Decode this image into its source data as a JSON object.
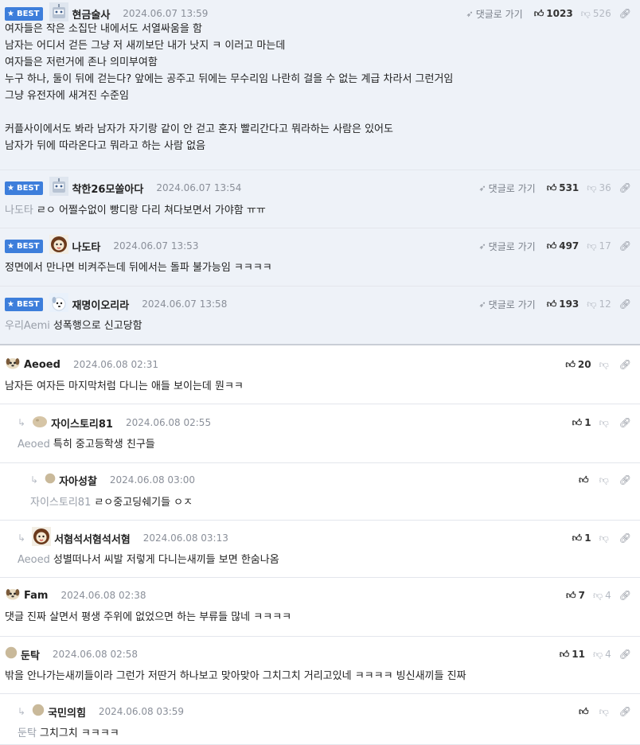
{
  "labels": {
    "best": "BEST",
    "goto": "댓글로 가기"
  },
  "colors": {
    "best_bg": "#eef2f8",
    "badge": "#3d7edb"
  },
  "comments": [
    {
      "best": true,
      "nick": "현금술사",
      "date": "2024.06.07 13:59",
      "likes": "1023",
      "dislikes": "526",
      "avatar": "robot-avatar",
      "lines": [
        "여자들은 작은 소집단 내에서도 서열싸움을 함",
        "남자는 어디서 걷든 그냥 저 새끼보단 내가 낫지 ㅋ 이러고 마는데",
        "여자들은 저런거에 존나 의미부여함",
        "누구 하나, 둘이 뒤에 걷는다? 앞에는 공주고 뒤에는 무수리임 나란히 걸을 수 없는 계급 차라서 그런거임",
        "그냥 유전자에 새겨진 수준임",
        "",
        "커플사이에서도 봐라 남자가 자기랑 같이 안 걷고 혼자 빨리간다고 뭐라하는 사람은 있어도",
        "남자가 뒤에 따라온다고 뭐라고 하는 사람 없음"
      ]
    },
    {
      "best": true,
      "nick": "착한26모쏠아다",
      "date": "2024.06.07 13:54",
      "likes": "531",
      "dislikes": "36",
      "avatar": "robot-avatar",
      "mention": "나도타",
      "text": "ㄹㅇ 어쩔수없이 빵디랑 다리 쳐다보면서 가야함 ㅠㅠ"
    },
    {
      "best": true,
      "nick": "나도타",
      "date": "2024.06.07 13:53",
      "likes": "497",
      "dislikes": "17",
      "avatar": "lion-avatar",
      "text": "정면에서 만나면 비켜주는데 뒤에서는 돌파 불가능임 ㅋㅋㅋㅋ"
    },
    {
      "best": true,
      "nick": "재명이오리라",
      "date": "2024.06.07 13:58",
      "likes": "193",
      "dislikes": "12",
      "avatar": "dog-avatar",
      "mention": "우리Aemi",
      "text": "성폭행으로 신고당함"
    },
    {
      "nick": "Aeoed",
      "date": "2024.06.08 02:31",
      "likes": "20",
      "dislikes": "",
      "avatar": "puppy-avatar",
      "text": "남자든 여자든 마지막처럼 다니는 애들 보이는데 뭔ㅋㅋ"
    },
    {
      "nick": "자이스토리81",
      "date": "2024.06.08 02:55",
      "likes": "1",
      "dislikes": "",
      "avatar": "blob-avatar",
      "mention": "Aeoed",
      "text": "특히 중고등학생 친구들"
    },
    {
      "nick": "자아성찰",
      "date": "2024.06.08 03:00",
      "likes": "",
      "dislikes": "",
      "avatar": "dot-avatar",
      "mention": "자이스토리81",
      "text": "ㄹㅇ중고딩쉐기들 ㅇㅈ"
    },
    {
      "nick": "서혐석서혐석서혐",
      "date": "2024.06.08 03:13",
      "likes": "1",
      "dislikes": "",
      "avatar": "lion-avatar",
      "mention": "Aeoed",
      "text": "성별떠나서 씨발 저렇게 다니는새끼들 보면 한숨나옴"
    },
    {
      "nick": "Fam",
      "date": "2024.06.08 02:38",
      "likes": "7",
      "dislikes": "4",
      "avatar": "puppy-avatar",
      "text": "댓글 진짜 살면서 평생 주위에 없었으면 하는 부류들 많네 ㅋㅋㅋㅋ"
    },
    {
      "nick": "둔탁",
      "date": "2024.06.08 02:58",
      "likes": "11",
      "dislikes": "4",
      "avatar": "dot-avatar",
      "text": "밖을 안나가는새끼들이라 그런가 저딴거 하나보고 맞아맞아 그치그치 거리고있네 ㅋㅋㅋㅋ 빙신새끼들 진짜"
    },
    {
      "nick": "국민의힘",
      "date": "2024.06.08 03:59",
      "likes": "",
      "dislikes": "",
      "avatar": "dot-avatar",
      "mention": "둔탁",
      "text": "그치그치 ㅋㅋㅋㅋ"
    }
  ]
}
